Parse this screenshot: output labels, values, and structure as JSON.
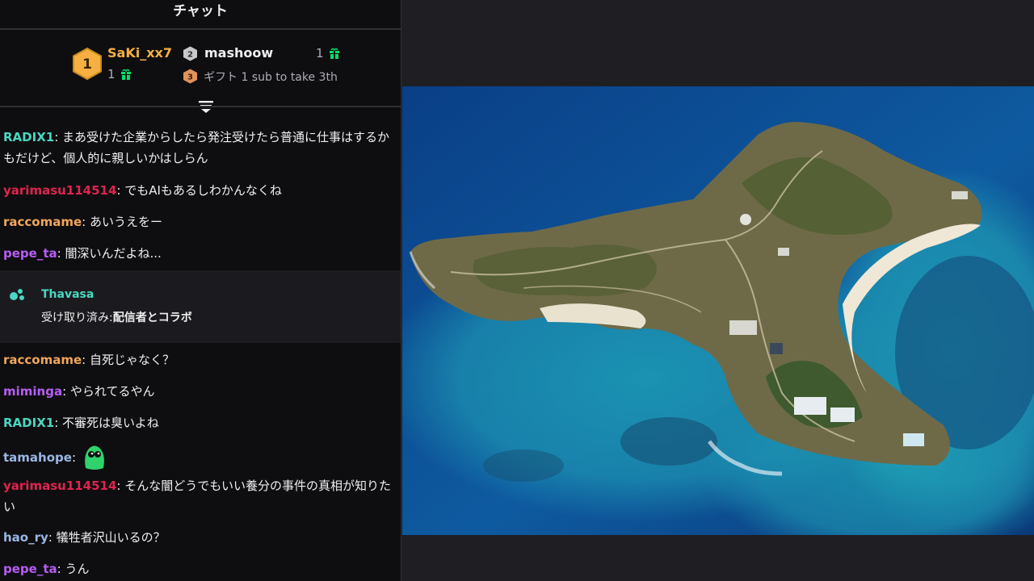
{
  "chat": {
    "title": "チャット",
    "leaderboard": {
      "first": {
        "rank": "1",
        "name": "SaKi_xx7",
        "count": "1"
      },
      "second": {
        "rank": "2",
        "name": "mashoow",
        "count": "1"
      },
      "third": {
        "rank": "3",
        "text": "ギフト 1 sub to take 3th"
      }
    },
    "messages": [
      {
        "user": "RADIX1",
        "text": "まあ受けた企業からしたら発注受けたら普通に仕事はするかもだけど、個人的に親しいかはしらん"
      },
      {
        "user": "yarimasu114514",
        "text": "でもAIもあるしわかんなくね"
      },
      {
        "user": "raccomame",
        "text": "あいうえをー"
      },
      {
        "user": "pepe_ta",
        "text": "闇深いんだよね..."
      },
      {
        "user": "raccomame",
        "text": "自死じゃなく？"
      },
      {
        "user": "miminga",
        "text": "やられてるやん"
      },
      {
        "user": "RADIX1",
        "text": "不審死は臭いよね"
      },
      {
        "user": "tamahope",
        "text": ""
      },
      {
        "user": "yarimasu114514",
        "text": "そんな闇どうでもいい養分の事件の真相が知りたい"
      },
      {
        "user": "hao_ry",
        "text": "犠牲者沢山いるの？"
      },
      {
        "user": "pepe_ta",
        "text": "うん"
      }
    ],
    "notice": {
      "user": "Thavasa",
      "prefix": "受け取り済み:",
      "reward": "配信者とコラボ"
    }
  },
  "colors": {
    "background": "#0e0e10",
    "stage": "#1f1f23",
    "gold": "#f5b041",
    "gift_green": "#00e06b",
    "teal": "#4ad7c1",
    "red": "#e0234e",
    "orange": "#f2a65a",
    "purple": "#b75cf5",
    "blue": "#9ab7e5"
  },
  "icons": {
    "rank1": "gold-hexagon-badge-icon",
    "rank2": "silver-hexagon-badge-icon",
    "rank3": "bronze-hexagon-badge-icon",
    "gift": "gift-icon",
    "collapse": "collapse-list-icon",
    "channel_points": "channel-points-icon",
    "emote": "green-blob-emote"
  }
}
